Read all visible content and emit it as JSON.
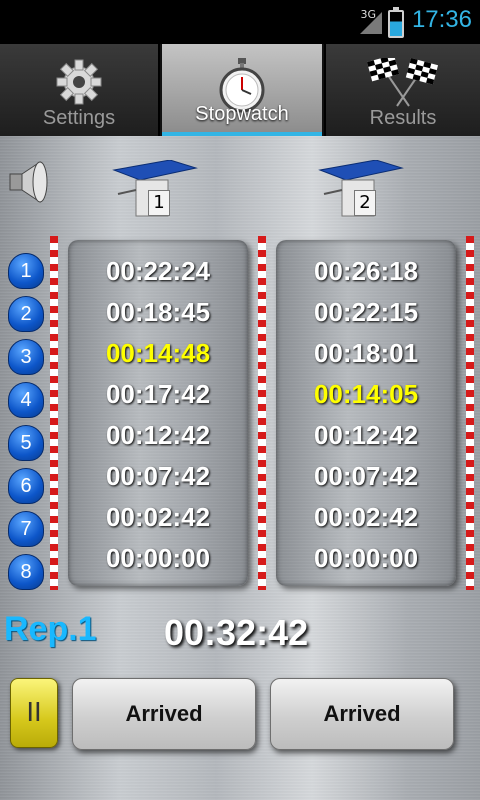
{
  "status_bar": {
    "network": "3G",
    "time": "17:36",
    "accent_color": "#33b5e5"
  },
  "tabs": [
    {
      "label": "Settings",
      "icon": "gear-icon"
    },
    {
      "label": "Stopwatch",
      "icon": "stopwatch-icon",
      "selected": true
    },
    {
      "label": "Results",
      "icon": "checkered-flags-icon"
    }
  ],
  "sound_icon": "speaker-icon",
  "lanes": [
    {
      "label": "1",
      "icon": "starting-block-icon"
    },
    {
      "label": "2",
      "icon": "starting-block-icon"
    }
  ],
  "laps": [
    "1",
    "2",
    "3",
    "4",
    "5",
    "6",
    "7",
    "8"
  ],
  "lane1_times": [
    "00:22:24",
    "00:18:45",
    "00:14:48",
    "00:17:42",
    "00:12:42",
    "00:07:42",
    "00:02:42",
    "00:00:00"
  ],
  "lane2_times": [
    "00:26:18",
    "00:22:15",
    "00:18:01",
    "00:14:05",
    "00:12:42",
    "00:07:42",
    "00:02:42",
    "00:00:00"
  ],
  "highlighted": {
    "lane1_row": 3,
    "lane2_row": 4,
    "color": "#ffff00"
  },
  "footer": {
    "repetition": "Rep.1",
    "total_time": "00:32:42",
    "pause_label": "II",
    "arrived_lane1": "Arrived",
    "arrived_lane2": "Arrived"
  }
}
